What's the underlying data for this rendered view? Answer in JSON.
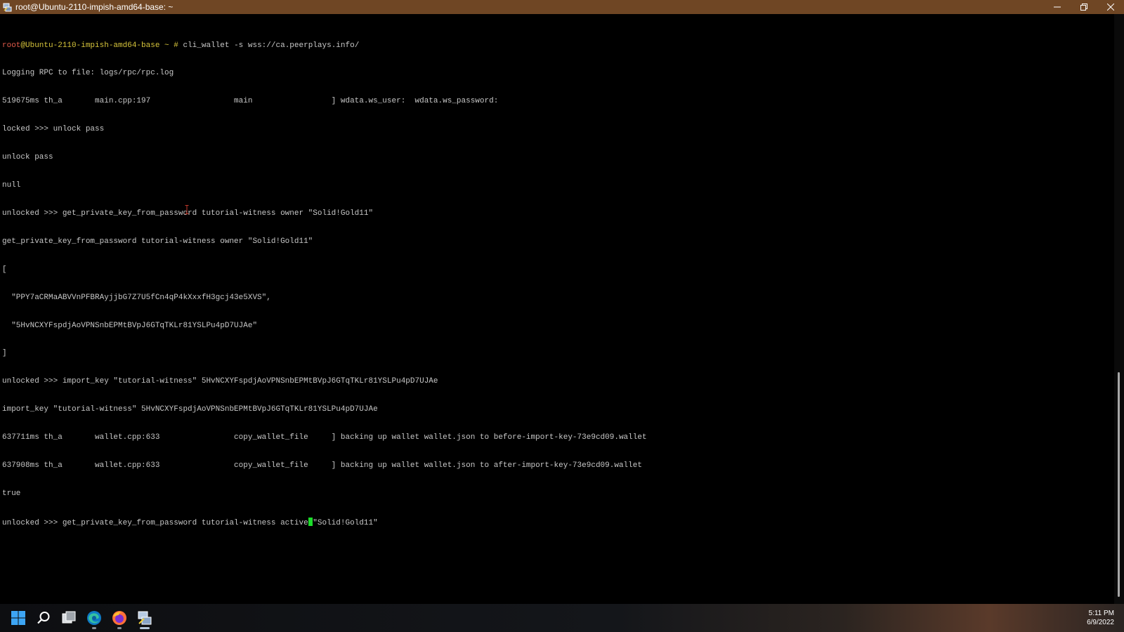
{
  "window": {
    "title": "root@Ubuntu-2110-impish-amd64-base: ~",
    "icon": "putty-icon",
    "controls": [
      "minimize-icon",
      "restore-icon",
      "close-icon"
    ]
  },
  "terminal": {
    "prompt": {
      "user": "root",
      "host": "@Ubuntu-2110-impish-amd64-base",
      "suffix": " ~ # ",
      "command": "cli_wallet -s wss://ca.peerplays.info/"
    },
    "lines": [
      "Logging RPC to file: logs/rpc/rpc.log",
      "519675ms th_a       main.cpp:197                  main                 ] wdata.ws_user:  wdata.ws_password:",
      "locked >>> unlock pass",
      "unlock pass",
      "null",
      "unlocked >>> get_private_key_from_password tutorial-witness owner \"Solid!Gold11\"",
      "get_private_key_from_password tutorial-witness owner \"Solid!Gold11\"",
      "[",
      "  \"PPY7aCRMaABVVnPFBRAyjjbG7Z7U5fCn4qP4kXxxfH3gcj43e5XVS\",",
      "  \"5HvNCXYFspdjAoVPNSnbEPMtBVpJ6GTqTKLr81YSLPu4pD7UJAe\"",
      "]",
      "unlocked >>> import_key \"tutorial-witness\" 5HvNCXYFspdjAoVPNSnbEPMtBVpJ6GTqTKLr81YSLPu4pD7UJAe",
      "import_key \"tutorial-witness\" 5HvNCXYFspdjAoVPNSnbEPMtBVpJ6GTqTKLr81YSLPu4pD7UJAe",
      "637711ms th_a       wallet.cpp:633                copy_wallet_file     ] backing up wallet wallet.json to before-import-key-73e9cd09.wallet",
      "637908ms th_a       wallet.cpp:633                copy_wallet_file     ] backing up wallet wallet.json to after-import-key-73e9cd09.wallet",
      "true"
    ],
    "current_input": {
      "before_cursor": "unlocked >>> get_private_key_from_password tutorial-witness active",
      "after_cursor": "\"Solid!Gold11\""
    },
    "cursor_color": "#1cdc2a"
  },
  "taskbar": {
    "apps": [
      {
        "name": "start-icon"
      },
      {
        "name": "search-icon"
      },
      {
        "name": "task-view-icon"
      },
      {
        "name": "edge-icon"
      },
      {
        "name": "firefox-icon"
      },
      {
        "name": "putty-icon"
      }
    ],
    "time": "5:11 PM",
    "date": "6/9/2022"
  }
}
